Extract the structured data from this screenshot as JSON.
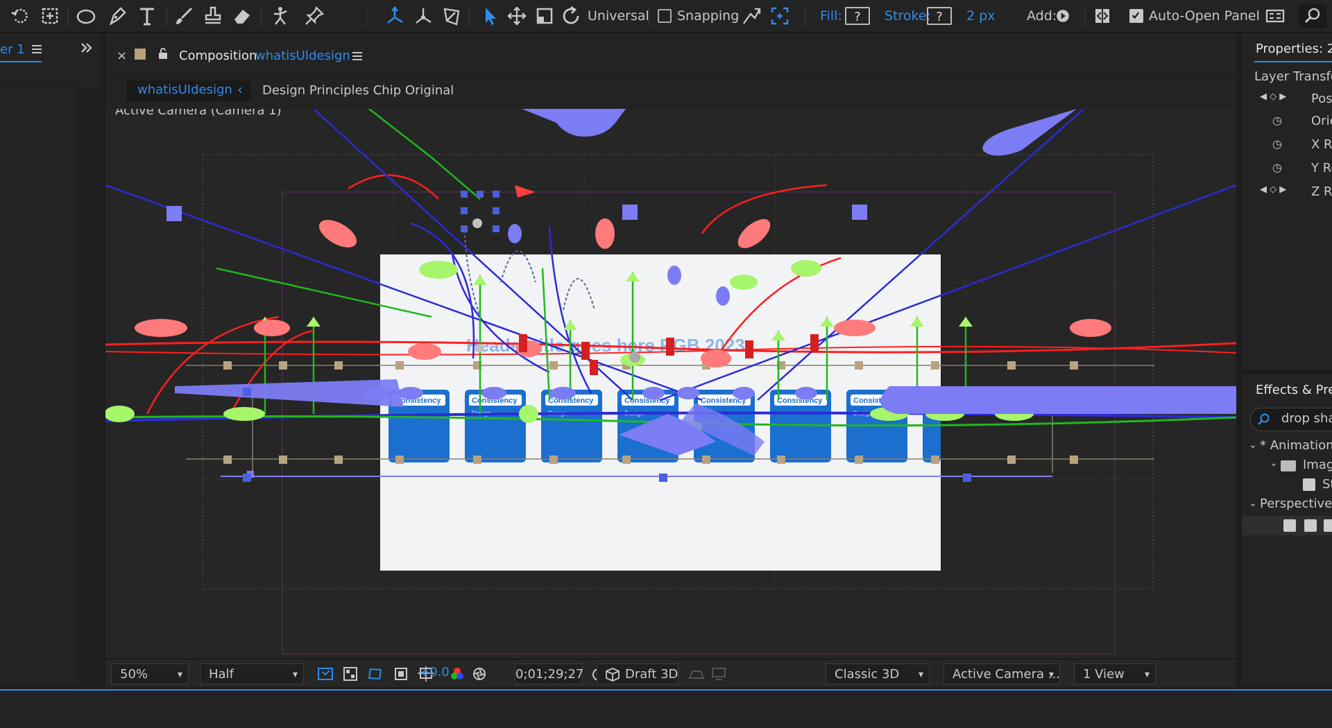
{
  "toolbar": {
    "universal_label": "Universal",
    "snapping_label": "Snapping",
    "fill_label": "Fill:",
    "fill_value": "?",
    "stroke_label": "Stroke:",
    "stroke_value": "?",
    "stroke_width": "2 px",
    "add_label": "Add:",
    "auto_open_label": "Auto-Open Panel"
  },
  "left_panel": {
    "tab_label": "er 1"
  },
  "composition": {
    "close_glyph": "×",
    "title_prefix": "Composition",
    "comp_name": "whatisUIdesign",
    "breadcrumb_active": "whatisUIdesign",
    "breadcrumb_child": "Design Principles Chip Original",
    "view_label": "Active Camera (Camera 1)"
  },
  "viewer_content": {
    "card_label": "Consistency",
    "card_sub": "Design",
    "banner_text": "Header title goes here RGB 2023",
    "card_count": 8
  },
  "view_bar": {
    "zoom": "50%",
    "resolution": "Half",
    "exposure": "+0.0",
    "timecode": "0;01;29;27",
    "draft3d": "Draft 3D",
    "renderer": "Classic 3D",
    "camera": "Active Camera ...",
    "views": "1 View"
  },
  "right_panel": {
    "properties_title": "Properties: 2(",
    "layer_transform": "Layer Transfo",
    "props": [
      "Pos",
      "Orie",
      "X Ro",
      "Y Ro",
      "Z Ro"
    ],
    "effects_title": "Effects & Pres",
    "search_value": "drop sha",
    "tree_animation": "* Animation",
    "tree_image": "Imag",
    "tree_sub": "St",
    "tree_perspective": "Perspective"
  },
  "colors": {
    "accent": "#2d8ceb",
    "panel_bg": "#232323",
    "gizmo_red": "#ff2020",
    "gizmo_green": "#20c020",
    "gizmo_blue": "#3a3ad8",
    "handle_blue": "#7c7cf5"
  }
}
